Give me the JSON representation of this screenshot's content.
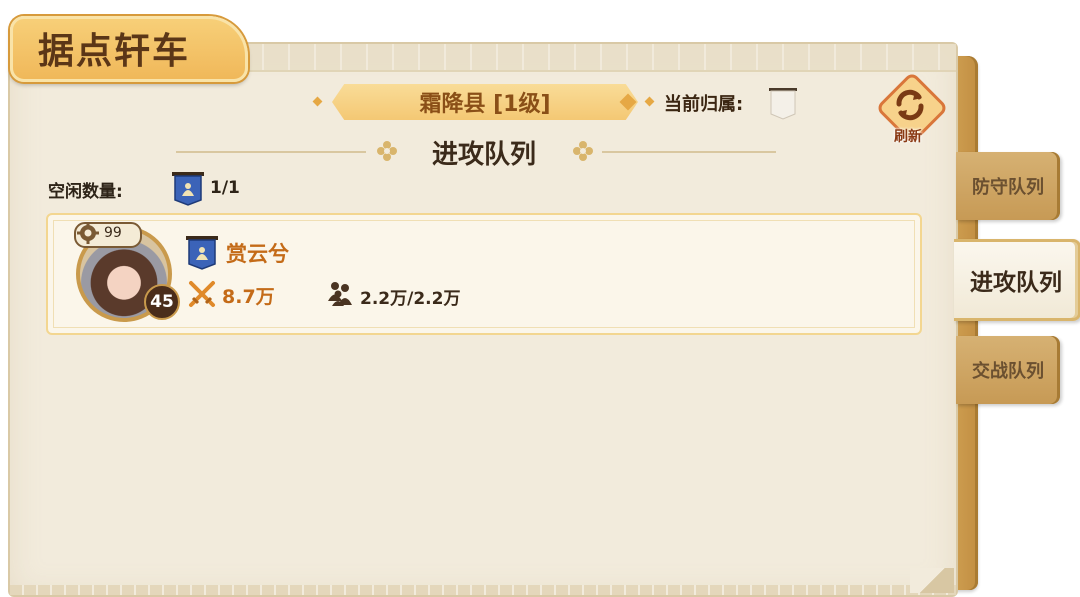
{
  "title": "据点轩车",
  "county": {
    "name": "霜降县 [1级]",
    "owner_label": "当前归属:"
  },
  "refresh": {
    "label": "刷新"
  },
  "section": {
    "heading": "进攻队列"
  },
  "idle": {
    "label": "空闲数量:",
    "count": "1/1"
  },
  "troop": {
    "star": "99",
    "level": "45",
    "name": "赏云兮",
    "power": "8.7万",
    "troops": "2.2万/2.2万"
  },
  "tabs": [
    {
      "label": "防守队列",
      "active": false
    },
    {
      "label": "进攻队列",
      "active": true
    },
    {
      "label": "交战队列",
      "active": false
    }
  ],
  "colors": {
    "accent_orange": "#c46b18",
    "paper": "#f2ebdc",
    "gold": "#f0b85a",
    "flag_blue": "#3b63b8"
  },
  "icons": {
    "refresh": "refresh-icon",
    "swords": "crossed-swords-icon",
    "troops": "troops-icon",
    "flag": "banner-flag-icon"
  }
}
